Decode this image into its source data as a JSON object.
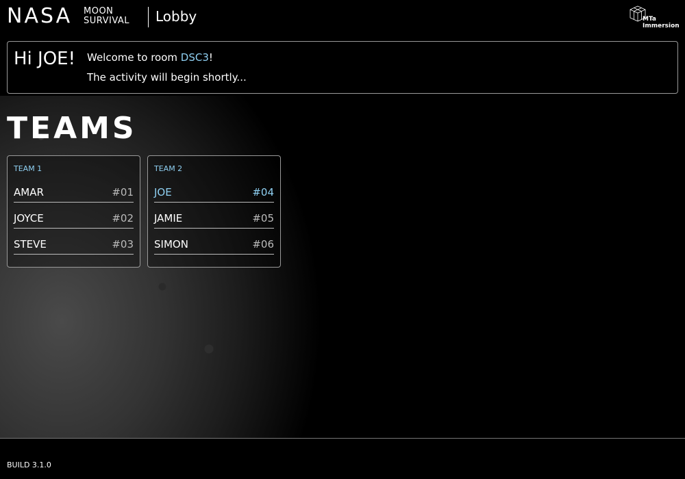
{
  "header": {
    "logo_nasa": "NASA",
    "logo_moon_line1": "MOON",
    "logo_moon_line2": "SURVIVAL",
    "page_label": "Lobby",
    "brand_line1": "MTa",
    "brand_line2": "Immersion"
  },
  "welcome": {
    "greeting": "Hi JOE!",
    "welcome_prefix": "Welcome to room ",
    "room_code": "DSC3",
    "welcome_suffix": "!",
    "status": "The activity will begin shortly..."
  },
  "teams_heading": "TEAMS",
  "teams": [
    {
      "name": "TEAM 1",
      "members": [
        {
          "name": "AMAR",
          "number": "#01"
        },
        {
          "name": "JOYCE",
          "number": "#02"
        },
        {
          "name": "STEVE",
          "number": "#03"
        }
      ]
    },
    {
      "name": "TEAM 2",
      "members": [
        {
          "name": "JOE",
          "number": "#04"
        },
        {
          "name": "JAMIE",
          "number": "#05"
        },
        {
          "name": "SIMON",
          "number": "#06"
        }
      ]
    }
  ],
  "footer": {
    "build": "BUILD 3.1.0"
  },
  "colors": {
    "accent": "#8fd0f2",
    "background": "#000000",
    "border": "#9a9a9a"
  }
}
